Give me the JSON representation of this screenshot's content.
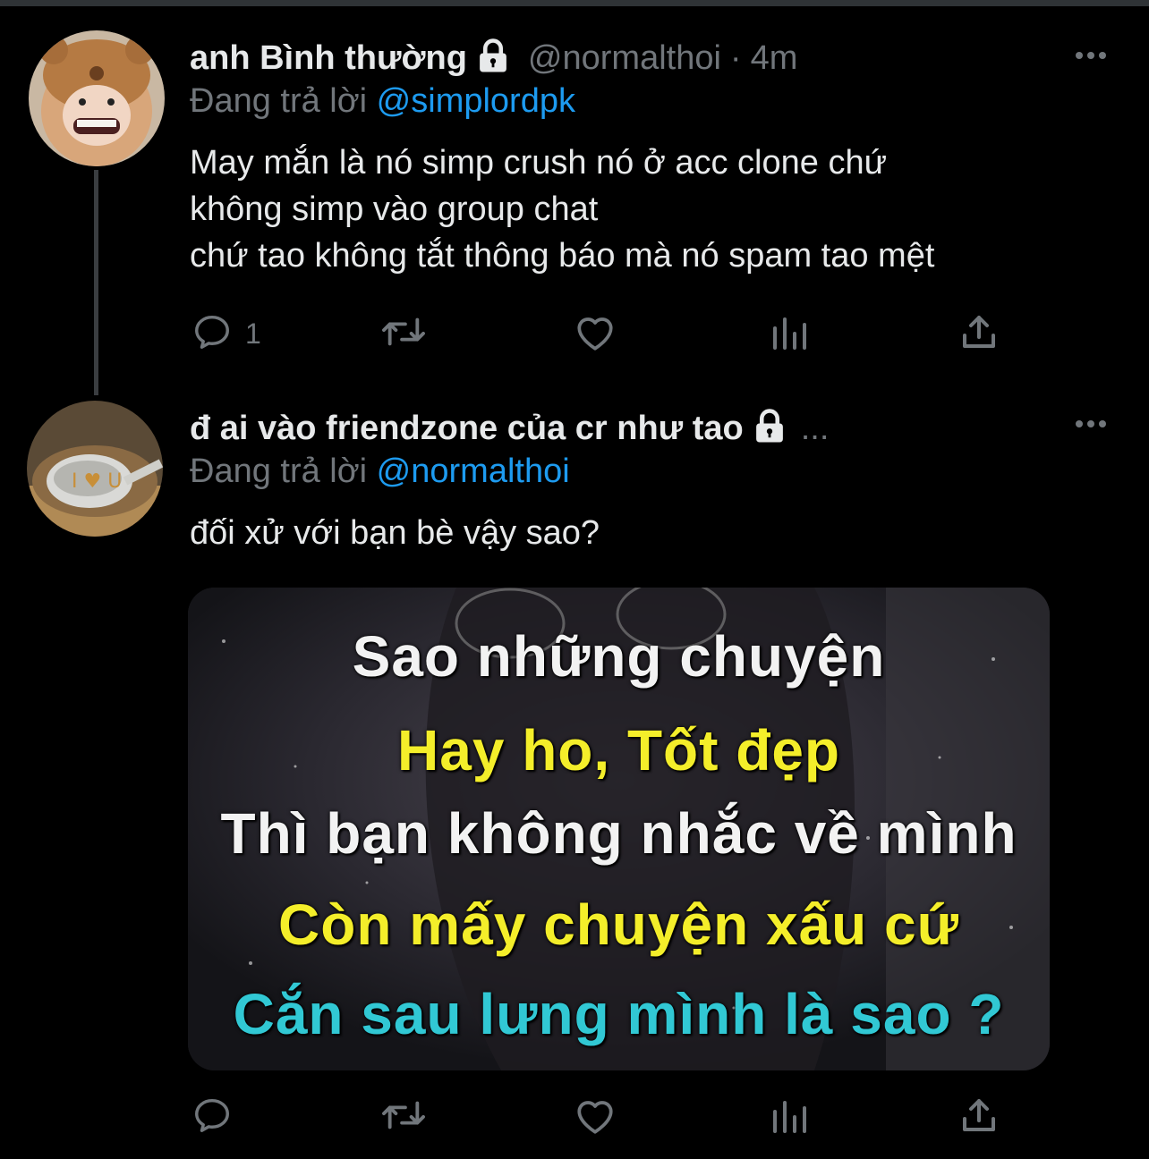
{
  "tweet1": {
    "name": "anh Bình thường",
    "handle": "@normalthoi",
    "dot": "·",
    "time": "4m",
    "reply_prefix": "Đang trả lời",
    "reply_mention": "@simplordpk",
    "lines": [
      "May mắn là nó simp crush nó ở acc clone chứ",
      "không simp vào group chat",
      "chứ tao không tắt thông báo mà nó spam tao mệt"
    ],
    "reply_count": "1"
  },
  "tweet2": {
    "name": "đ ai vào friendzone của cr như tao",
    "ellipsis": "...",
    "reply_prefix": "Đang trả lời",
    "reply_mention": "@normalthoi",
    "text": "đối xử với bạn bè vậy sao?",
    "image_lines": [
      "Sao những chuyện",
      "Hay ho, Tốt đẹp",
      "Thì bạn không nhắc về mình",
      "Còn mấy chuyện xấu cứ",
      "Cắn sau lưng mình là sao ?"
    ]
  },
  "icons": [
    "reply-icon",
    "retweet-icon",
    "like-icon",
    "analytics-icon",
    "share-icon",
    "lock-icon",
    "more-icon"
  ],
  "colors": {
    "background": "#000000",
    "text": "#e7e9ea",
    "muted": "#71767b",
    "accent": "#1d9bf0"
  }
}
